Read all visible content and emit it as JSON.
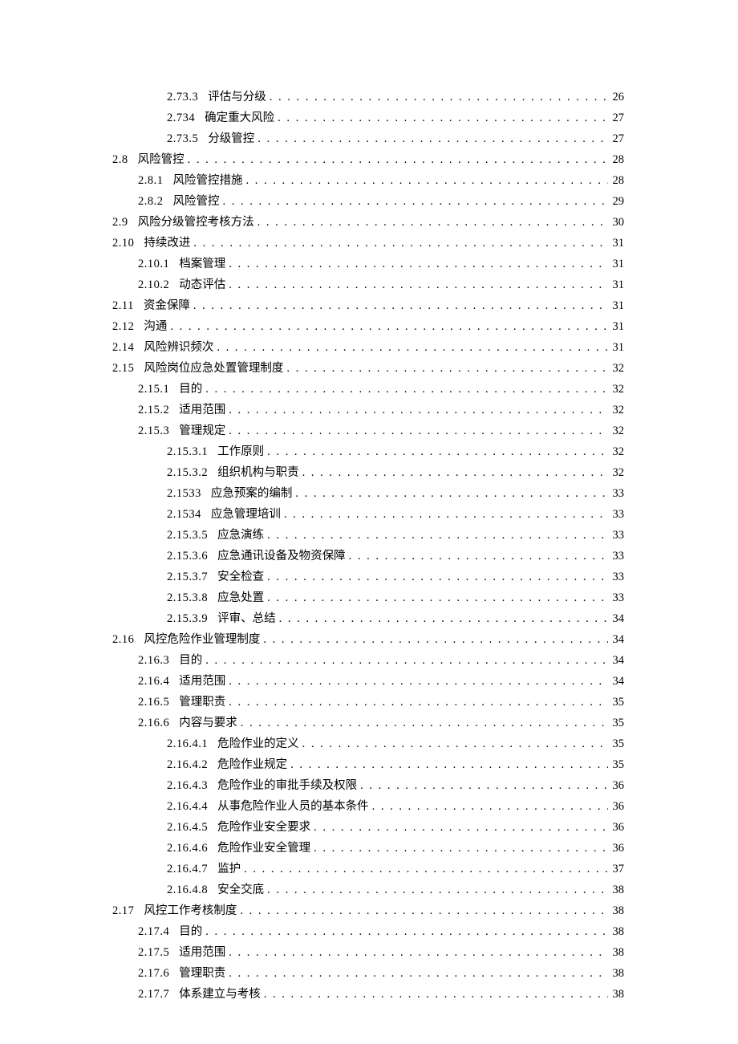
{
  "toc": [
    {
      "indent": 2,
      "num": "2.73.3",
      "title": "评估与分级",
      "page": "26"
    },
    {
      "indent": 2,
      "num": "2.734",
      "title": "确定重大风险",
      "page": "27"
    },
    {
      "indent": 2,
      "num": "2.73.5",
      "title": "分级管控",
      "page": "27"
    },
    {
      "indent": 0,
      "num": "2.8",
      "title": "风险管控",
      "page": "28"
    },
    {
      "indent": 1,
      "num": "2.8.1",
      "title": "风险管控措施",
      "page": "28"
    },
    {
      "indent": 1,
      "num": "2.8.2",
      "title": "风险管控",
      "page": "29"
    },
    {
      "indent": 0,
      "num": "2.9",
      "title": "风险分级管控考核方法",
      "page": "30"
    },
    {
      "indent": 0,
      "num": "2.10",
      "title": "持续改进",
      "page": "31"
    },
    {
      "indent": 1,
      "num": "2.10.1",
      "title": "档案管理",
      "page": "31"
    },
    {
      "indent": 1,
      "num": "2.10.2",
      "title": "动态评估",
      "page": "31"
    },
    {
      "indent": 0,
      "num": "2.11",
      "title": "资金保障",
      "page": "31"
    },
    {
      "indent": 0,
      "num": "2.12",
      "title": "沟通",
      "page": "31"
    },
    {
      "indent": 0,
      "num": "2.14",
      "title": "风险辨识频次",
      "page": "31"
    },
    {
      "indent": 0,
      "num": "2.15",
      "title": "风险岗位应急处置管理制度",
      "page": "32"
    },
    {
      "indent": 1,
      "num": "2.15.1",
      "title": "目的",
      "page": "32"
    },
    {
      "indent": 1,
      "num": "2.15.2",
      "title": "适用范围",
      "page": "32"
    },
    {
      "indent": 1,
      "num": "2.15.3",
      "title": "管理规定",
      "page": "32"
    },
    {
      "indent": 2,
      "num": "2.15.3.1",
      "title": "工作原则",
      "page": "32"
    },
    {
      "indent": 2,
      "num": "2.15.3.2",
      "title": "组织机构与职责",
      "page": "32"
    },
    {
      "indent": 2,
      "num": "2.1533",
      "title": "应急预案的编制",
      "page": "33"
    },
    {
      "indent": 2,
      "num": "2.1534",
      "title": "应急管理培训",
      "page": "33"
    },
    {
      "indent": 2,
      "num": "2.15.3.5",
      "title": "应急演练",
      "page": "33"
    },
    {
      "indent": 2,
      "num": "2.15.3.6",
      "title": "应急通讯设备及物资保障",
      "page": "33"
    },
    {
      "indent": 2,
      "num": "2.15.3.7",
      "title": "安全检查",
      "page": "33"
    },
    {
      "indent": 2,
      "num": "2.15.3.8",
      "title": "应急处置",
      "page": "33"
    },
    {
      "indent": 2,
      "num": "2.15.3.9",
      "title": "评审、总结",
      "page": "34"
    },
    {
      "indent": 0,
      "num": "2.16",
      "title": "风控危险作业管理制度",
      "page": "34"
    },
    {
      "indent": 1,
      "num": "2.16.3",
      "title": "目的",
      "page": "34"
    },
    {
      "indent": 1,
      "num": "2.16.4",
      "title": "适用范围",
      "page": "34"
    },
    {
      "indent": 1,
      "num": "2.16.5",
      "title": "管理职责",
      "page": "35"
    },
    {
      "indent": 1,
      "num": "2.16.6",
      "title": "内容与要求",
      "page": "35"
    },
    {
      "indent": 2,
      "num": "2.16.4.1",
      "title": "危险作业的定义",
      "page": "35"
    },
    {
      "indent": 2,
      "num": "2.16.4.2",
      "title": "危险作业规定",
      "page": "35"
    },
    {
      "indent": 2,
      "num": "2.16.4.3",
      "title": "危险作业的审批手续及权限",
      "page": "36"
    },
    {
      "indent": 2,
      "num": "2.16.4.4",
      "title": "从事危险作业人员的基本条件",
      "page": "36"
    },
    {
      "indent": 2,
      "num": "2.16.4.5",
      "title": "危险作业安全要求",
      "page": "36"
    },
    {
      "indent": 2,
      "num": "2.16.4.6",
      "title": "危险作业安全管理",
      "page": "36"
    },
    {
      "indent": 2,
      "num": "2.16.4.7",
      "title": "监护",
      "page": "37"
    },
    {
      "indent": 2,
      "num": "2.16.4.8",
      "title": "安全交底",
      "page": "38"
    },
    {
      "indent": 0,
      "num": "2.17",
      "title": "风控工作考核制度",
      "page": "38"
    },
    {
      "indent": 1,
      "num": "2.17.4",
      "title": "目的",
      "page": "38"
    },
    {
      "indent": 1,
      "num": "2.17.5",
      "title": "适用范围",
      "page": "38"
    },
    {
      "indent": 1,
      "num": "2.17.6",
      "title": "管理职责",
      "page": "38"
    },
    {
      "indent": 1,
      "num": "2.17.7",
      "title": "体系建立与考核",
      "page": "38"
    }
  ]
}
